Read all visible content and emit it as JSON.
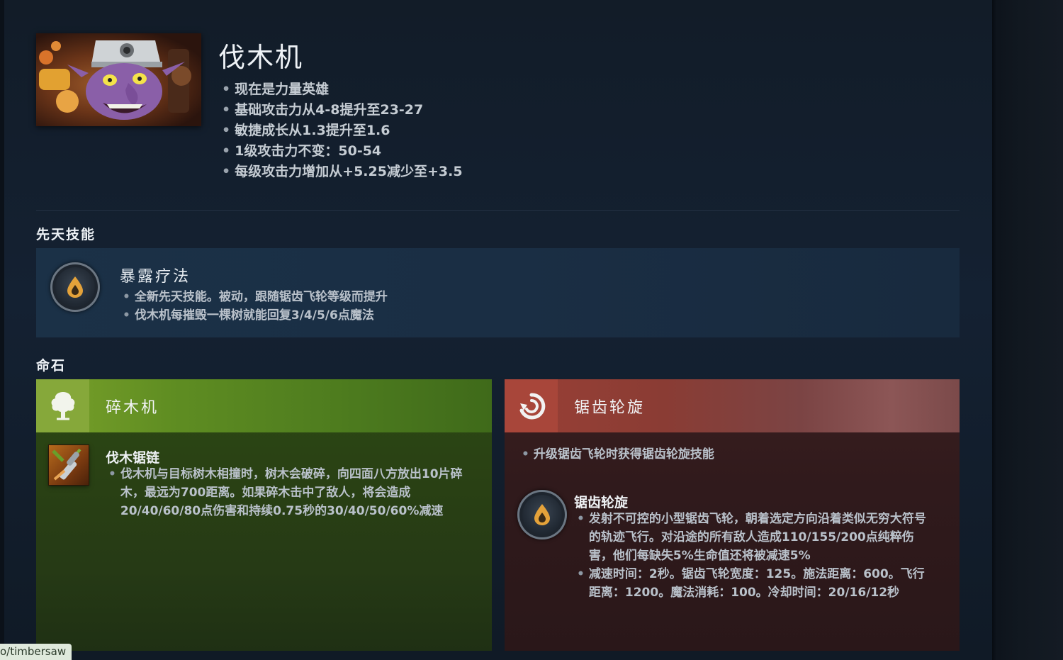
{
  "hero": {
    "name": "伐木机",
    "changes": [
      "现在是力量英雄",
      "基础攻击力从4-8提升至23-27",
      "敏捷成长从1.3提升至1.6",
      "1级攻击力不变：50-54",
      "每级攻击力增加从+5.25减少至+3.5"
    ]
  },
  "innate": {
    "section_title": "先天技能",
    "name": "暴露疗法",
    "icon": "drop-icon",
    "bullets": [
      "全新先天技能。被动，跟随锯齿飞轮等级而提升",
      "伐木机每摧毁一棵树就能回复3/4/5/6点魔法"
    ]
  },
  "facets": {
    "section_title": "命石",
    "green": {
      "title": "碎木机",
      "icon": "tree-icon",
      "color": "#6a9426",
      "ability": {
        "name": "伐木锯链",
        "icon": "chain-icon",
        "bullets": [
          "伐木机与目标树木相撞时，树木会破碎，向四面八方放出10片碎木，最远为700距离。如果碎木击中了敌人，将会造成20/40/60/80点伤害和持续0.75秒的30/40/50/60%减速"
        ]
      }
    },
    "red": {
      "title": "锯齿轮旋",
      "icon": "spiral-icon",
      "color": "#9a4036",
      "intro": "升级锯齿飞轮时获得锯齿轮旋技能",
      "ability": {
        "name": "锯齿轮旋",
        "icon": "drop-icon",
        "bullets": [
          "发射不可控的小型锯齿飞轮，朝着选定方向沿着类似无穷大符号的轨迹飞行。对沿途的所有敌人造成110/155/200点纯粹伤害，他们每缺失5%生命值还将被减速5%",
          "减速时间：2秒。锯齿飞轮宽度：125。施法距离：600。飞行距离：1200。魔法消耗：100。冷却时间：20/16/12秒"
        ]
      }
    }
  },
  "status_bar": {
    "url": "o/timbersaw"
  }
}
